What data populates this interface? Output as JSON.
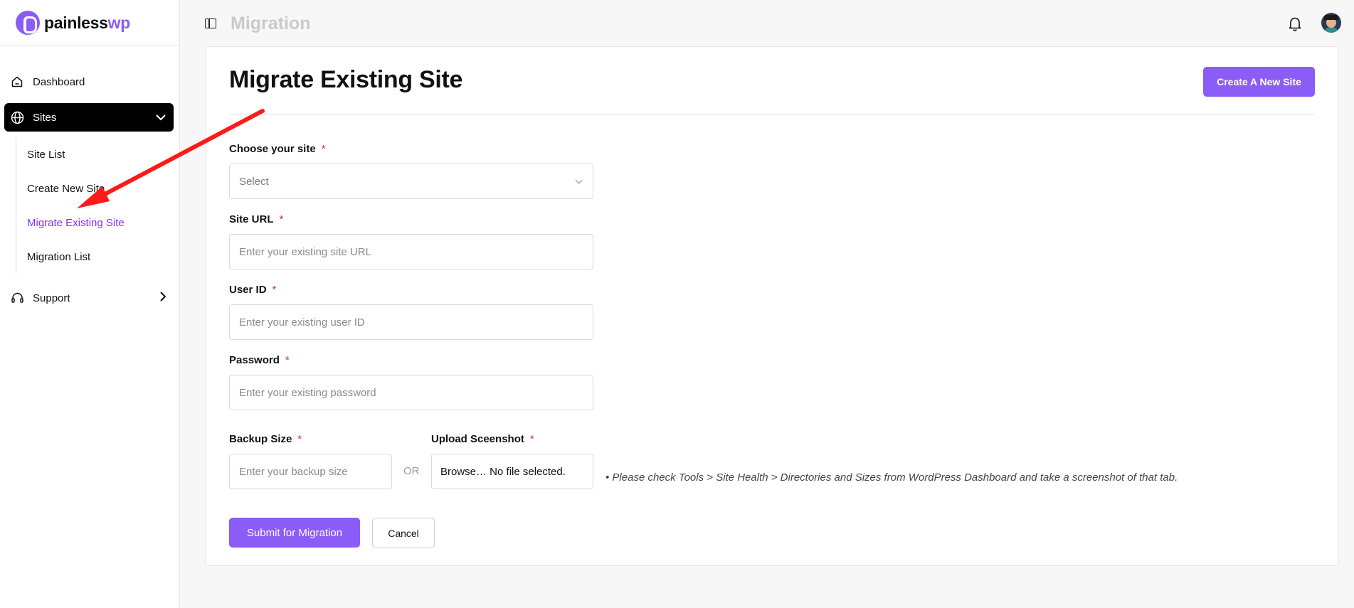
{
  "brand": {
    "name_part1": "painless",
    "name_part2": "wp"
  },
  "sidebar": {
    "items": [
      {
        "label": "Dashboard"
      },
      {
        "label": "Sites"
      },
      {
        "label": "Support"
      }
    ],
    "sites_subitems": [
      {
        "label": "Site List"
      },
      {
        "label": "Create New Site"
      },
      {
        "label": "Migrate Existing Site"
      },
      {
        "label": "Migration List"
      }
    ]
  },
  "header": {
    "title": "Migration"
  },
  "main": {
    "title": "Migrate Existing Site",
    "create_button": "Create A New Site",
    "fields": {
      "choose_site": {
        "label": "Choose your site",
        "value": "Select"
      },
      "site_url": {
        "label": "Site URL",
        "placeholder": "Enter your existing site URL"
      },
      "user_id": {
        "label": "User ID",
        "placeholder": "Enter your existing user ID"
      },
      "password": {
        "label": "Password",
        "placeholder": "Enter your existing password"
      },
      "backup_size": {
        "label": "Backup Size",
        "placeholder": "Enter your backup size"
      },
      "upload": {
        "label": "Upload Sceenshot",
        "value": "Browse… No file selected."
      }
    },
    "required_mark": "*",
    "or_text": "OR",
    "hint": "• Please check Tools > Site Health > Directories and Sizes from WordPress Dashboard and take a screenshot of that tab.",
    "submit_button": "Submit for Migration",
    "cancel_button": "Cancel"
  },
  "colors": {
    "accent": "#8b5cf6",
    "active_link": "#8b2ee6",
    "annotation_arrow": "#ff1a1a"
  }
}
